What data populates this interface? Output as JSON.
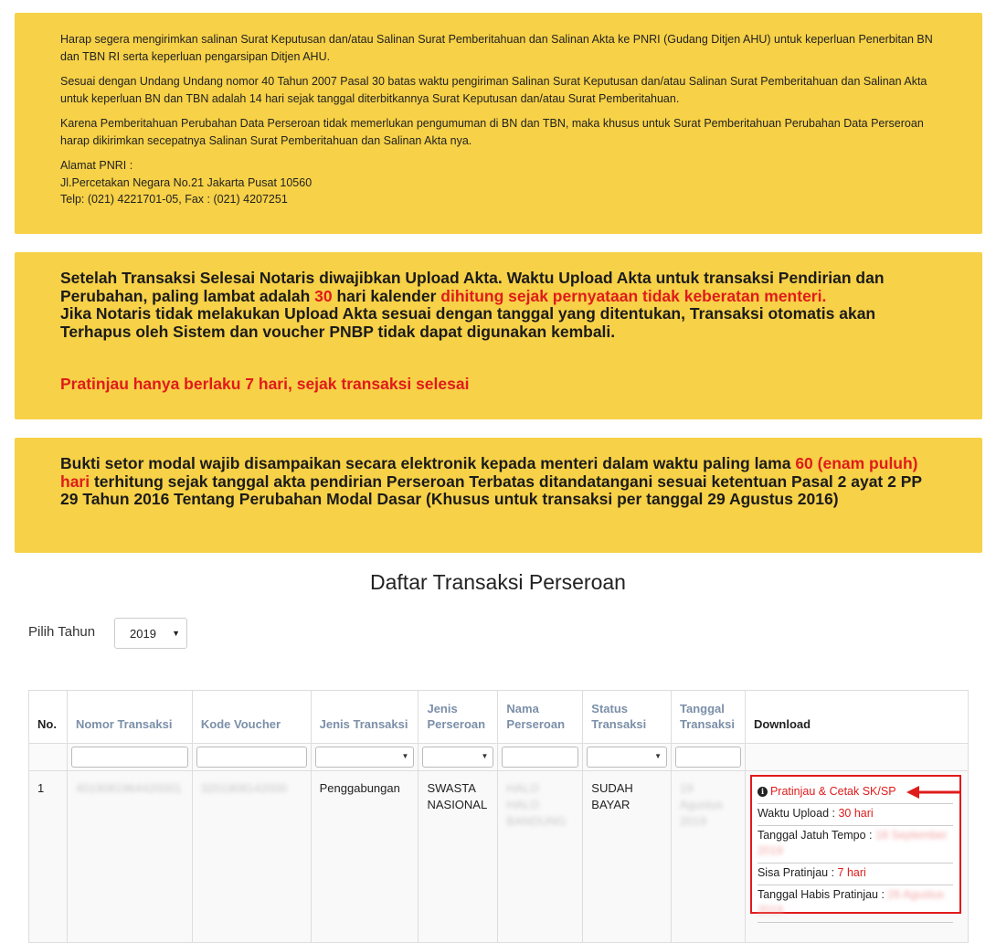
{
  "notice1": {
    "p1": "Harap segera mengirimkan salinan Surat Keputusan dan/atau Salinan Surat Pemberitahuan dan Salinan Akta ke PNRI (Gudang Ditjen AHU) untuk keperluan Penerbitan BN dan TBN RI serta keperluan pengarsipan Ditjen AHU.",
    "p2": "Sesuai dengan Undang Undang nomor 40 Tahun 2007 Pasal 30 batas waktu pengiriman Salinan Surat Keputusan dan/atau Salinan Surat Pemberitahuan dan Salinan Akta untuk keperluan BN dan TBN adalah 14 hari sejak tanggal diterbitkannya Surat Keputusan dan/atau Surat Pemberitahuan.",
    "p3": "Karena Pemberitahuan Perubahan Data Perseroan tidak memerlukan pengumuman di BN dan TBN, maka khusus untuk Surat Pemberitahuan Perubahan Data Perseroan harap dikirimkan secepatnya Salinan Surat Pemberitahuan dan Salinan Akta nya.",
    "addr_title": "Alamat PNRI :",
    "addr_line": "Jl.Percetakan Negara No.21 Jakarta Pusat 10560",
    "addr_phone": "Telp: (021) 4221701-05, Fax : (021) 4207251"
  },
  "notice2": {
    "t1": "Setelah Transaksi Selesai Notaris diwajibkan Upload Akta. Waktu Upload Akta untuk transaksi Pendirian dan Perubahan, paling lambat adalah ",
    "t2": "30",
    "t3": " hari kalender ",
    "t4": "dihitung sejak pernyataan tidak keberatan menteri.",
    "t5": "Jika Notaris tidak melakukan Upload Akta sesuai dengan tanggal yang ditentukan, Transaksi otomatis akan Terhapus oleh Sistem dan voucher PNBP tidak dapat digunakan kembali.",
    "preview_note": "Pratinjau hanya berlaku 7 hari, sejak transaksi selesai"
  },
  "notice3": {
    "t1": "Bukti setor modal wajib disampaikan secara elektronik kepada menteri dalam waktu paling lama ",
    "t2": "60 (enam puluh) hari",
    "t3": " terhitung sejak tanggal akta pendirian Perseroan Terbatas ditandatangani sesuai ketentuan Pasal 2 ayat 2 PP 29 Tahun 2016 Tentang Perubahan Modal Dasar (Khusus untuk transaksi per tanggal 29 Agustus 2016)"
  },
  "page_title": "Daftar Transaksi Perseroan",
  "year_filter": {
    "label": "Pilih Tahun",
    "value": "2019"
  },
  "table": {
    "headers": [
      "No.",
      "Nomor Transaksi",
      "Kode Voucher",
      "Jenis Transaksi",
      "Jenis Perseroan",
      "Nama Perseroan",
      "Status Transaksi",
      "Tanggal Transaksi",
      "Download"
    ],
    "row": {
      "no": "1",
      "nomor": "4019081964420001",
      "voucher": "3201908142000",
      "jenis_transaksi": "Penggabungan",
      "jenis_perseroan": "SWASTA NASIONAL",
      "nama": "HALO HALO BANDUNG",
      "status": "SUDAH BAYAR",
      "tanggal": "19 Agustus 2019"
    }
  },
  "download": {
    "link_label": "Pratinjau & Cetak SK/SP",
    "upload_label": "Waktu Upload : ",
    "upload_value": "30 hari",
    "due_label": "Tanggal Jatuh Tempo : ",
    "due_value": "18 September 2019",
    "remaining_label": "Sisa Pratinjau : ",
    "remaining_value": "7 hari",
    "expire_label": "Tanggal Habis Pratinjau : ",
    "expire_value": "26 Agustus 2019"
  },
  "colors": {
    "notice_bg": "#f7d147",
    "accent_red": "#e01b1b",
    "status_green": "#2f8a2f"
  },
  "icons": [
    "info-icon",
    "red-arrow-icon",
    "caret-down-icon"
  ]
}
